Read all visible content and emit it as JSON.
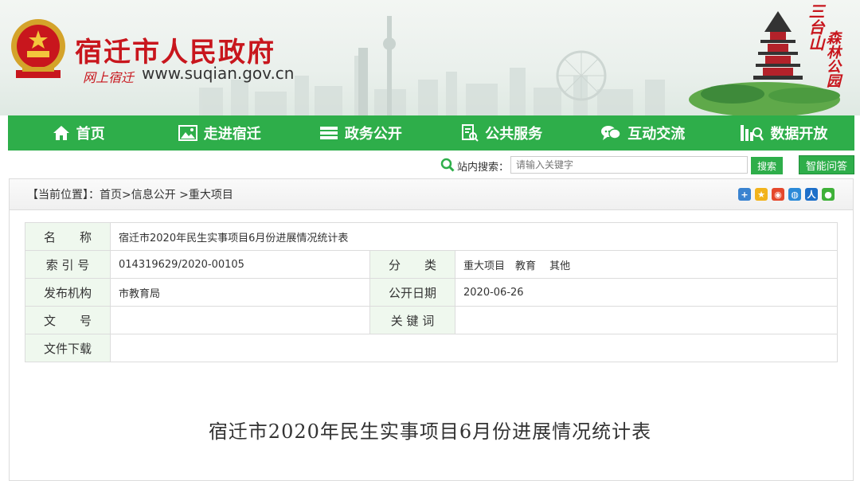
{
  "header": {
    "site_title": "宿迁市人民政府",
    "sub_calligraphy": "网上宿迁",
    "url": "www.suqian.gov.cn",
    "calligraphy_right_1": "三台山",
    "calligraphy_right_2": "森林公园"
  },
  "nav": {
    "items": [
      {
        "label": "首页",
        "icon": "home-icon"
      },
      {
        "label": "走进宿迁",
        "icon": "picture-icon"
      },
      {
        "label": "政务公开",
        "icon": "stack-icon"
      },
      {
        "label": "公共服务",
        "icon": "document-search-icon"
      },
      {
        "label": "互动交流",
        "icon": "chat-icon"
      },
      {
        "label": "数据开放",
        "icon": "data-search-icon"
      }
    ]
  },
  "search": {
    "label": "站内搜索：",
    "placeholder": "请输入关键字",
    "button": "搜索",
    "ai_button": "智能问答"
  },
  "breadcrumb": {
    "label": "【当前位置】：",
    "items": [
      "首页",
      ">信息公开",
      " >重大项目"
    ]
  },
  "share_icons": [
    "plus-share-icon",
    "qzone-icon",
    "weibo-icon",
    "qq-icon",
    "renren-icon",
    "wechat-icon"
  ],
  "info": {
    "name_label": "名　　称",
    "name_value": "宿迁市2020年民生实事项目6月份进展情况统计表",
    "index_label": "索 引 号",
    "index_value": "014319629/2020-00105",
    "category_label": "分　　类",
    "category_value": "重大项目　教育　 其他",
    "publisher_label": "发布机构",
    "publisher_value": "市教育局",
    "date_label": "公开日期",
    "date_value": "2020-06-26",
    "docnum_label": "文　　号",
    "docnum_value": "",
    "keywords_label": "关 键 词",
    "keywords_value": "",
    "download_label": "文件下载",
    "download_value": ""
  },
  "doc_title": "宿迁市2020年民生实事项目6月份进展情况统计表",
  "colors": {
    "nav_green": "#2eae4a",
    "title_red": "#c8161d",
    "label_bg": "#eff8ee"
  }
}
